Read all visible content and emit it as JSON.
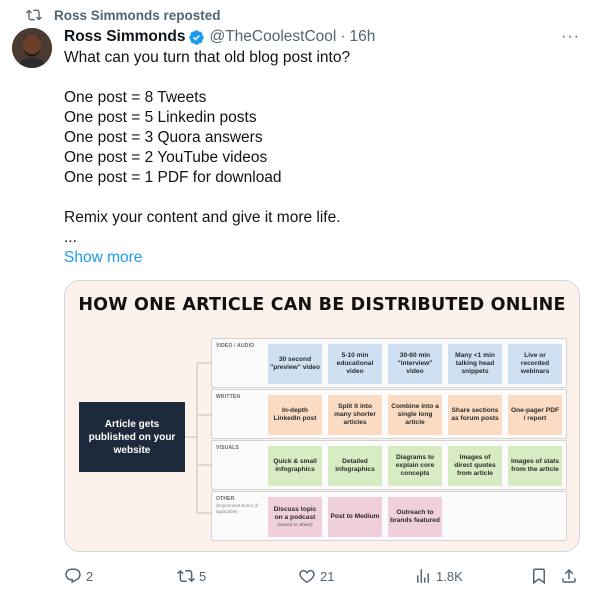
{
  "repost": {
    "label": "Ross Simmonds reposted",
    "icon": "repost-icon"
  },
  "tweet": {
    "author_name": "Ross Simmonds",
    "handle": "@TheCoolestCool",
    "separator": "·",
    "time": "16h",
    "more_label": "···",
    "body_lines": [
      "What can you turn that old blog post into?",
      "",
      "One post = 8 Tweets",
      "One post = 5 Linkedin posts",
      "One post = 3 Quora answers",
      "One post = 2 YouTube videos",
      "One post = 1 PDF for download",
      "",
      "Remix your content and give it more life.",
      "..."
    ],
    "show_more": "Show more"
  },
  "infographic": {
    "title": "HOW ONE ARTICLE CAN BE DISTRIBUTED ONLINE",
    "hub_label": "Article gets published on your website",
    "rows": [
      {
        "label": "VIDEO / AUDIO",
        "sub": "",
        "color": "#cfe0f3",
        "cells": [
          "30 second \"preview\" video",
          "5-10 min educational video",
          "30-60 min \"interview\" video",
          "Many <1 min talking head snippets",
          "Live or recorded webinars"
        ]
      },
      {
        "label": "WRITTEN",
        "sub": "",
        "color": "#fbdcc2",
        "cells": [
          "In-depth LinkedIn post",
          "Split it into many shorter articles",
          "Combine into a single long article",
          "Share sections as forum posts",
          "One-pager PDF / report"
        ]
      },
      {
        "label": "VISUALS",
        "sub": "",
        "color": "#d8ecc3",
        "cells": [
          "Quick & small infographics",
          "Detailed infographics",
          "Diagrams to explain core concepts",
          "Images of direct quotes from article",
          "Images of stats from the article"
        ]
      },
      {
        "label": "OTHER",
        "sub": "(Experiment Zone) (if applicable)",
        "color": "#efcfdb",
        "cells": [
          "Discuss topic on a podcast",
          "Post to Medium",
          "Outreach to brands featured"
        ],
        "cell_notes": [
          "(owned or others)",
          "",
          ""
        ]
      }
    ]
  },
  "actions": {
    "replies": "2",
    "reposts": "5",
    "likes": "21",
    "views": "1.8K"
  }
}
